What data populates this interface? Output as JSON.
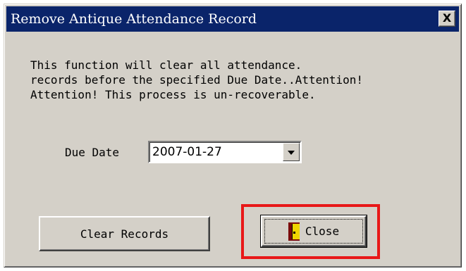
{
  "window": {
    "title": "Remove Antique Attendance Record",
    "close_glyph": "X"
  },
  "message": {
    "line1": "This function will clear all attendance.",
    "line2": "records before the specified Due Date..Attention!",
    "line3": "Attention! This process is un-recoverable."
  },
  "due_date": {
    "label": "Due Date",
    "value": "2007-01-27"
  },
  "buttons": {
    "clear_label": "Clear Records",
    "close_label": "Close",
    "close_icon": "door-exit-icon"
  },
  "colors": {
    "titlebar": "#0a246a",
    "dialog_face": "#d4d0c8",
    "highlight": "#e81818"
  }
}
